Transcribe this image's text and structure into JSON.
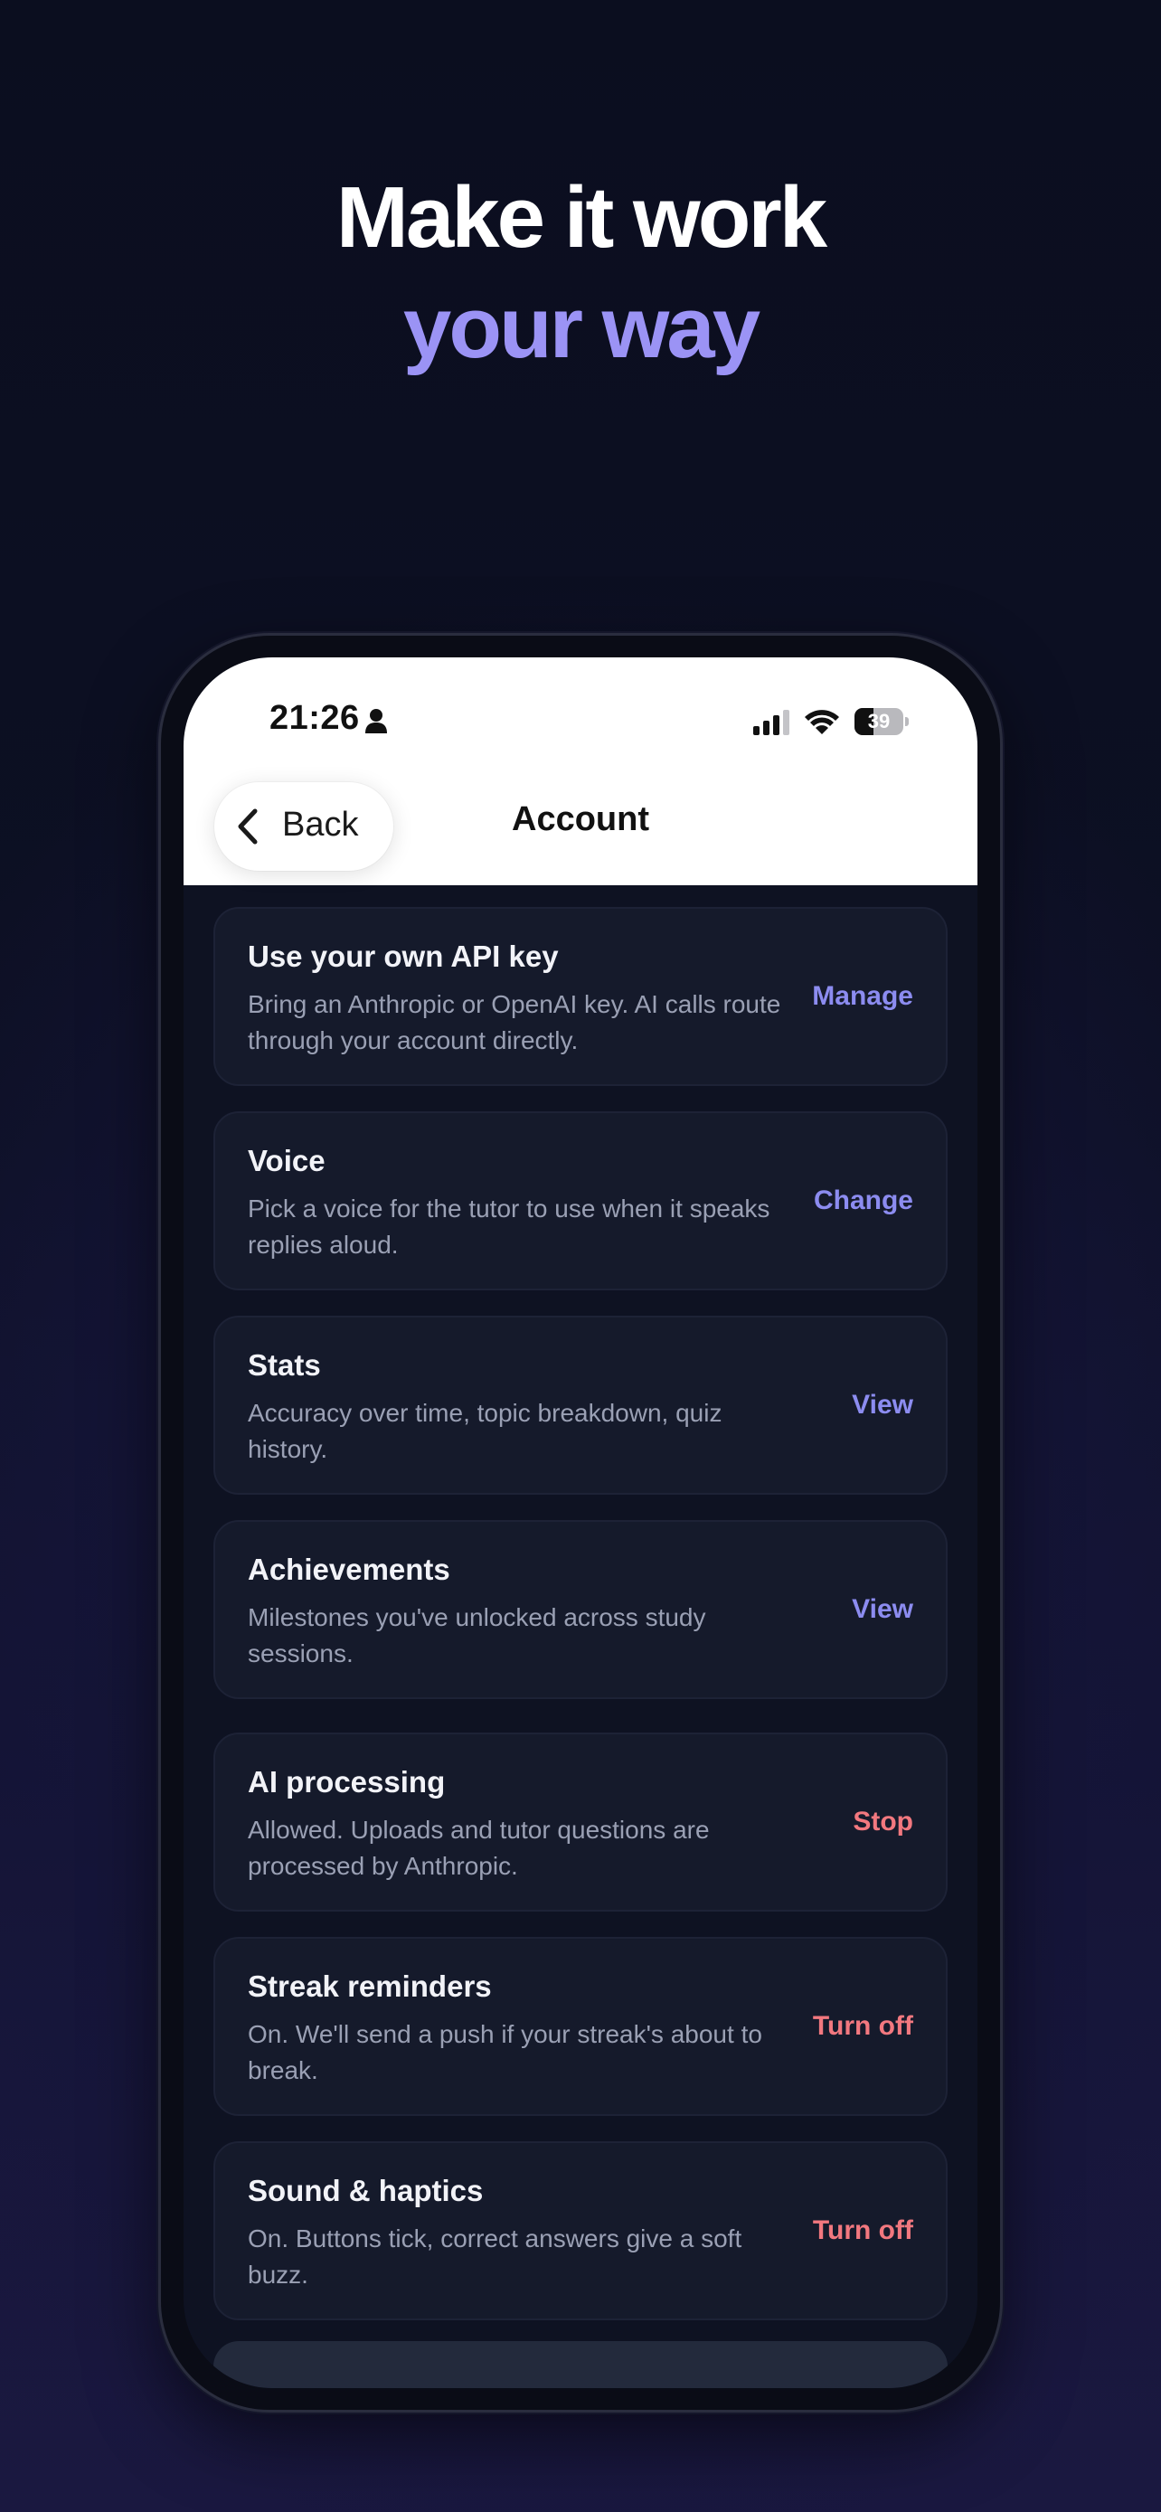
{
  "headline": {
    "line1": "Make it work",
    "line2": "your way",
    "accent_color": "#9b93f5"
  },
  "status_bar": {
    "time": "21:26",
    "battery": "39",
    "battery_level": 0.39,
    "icons": [
      "person-icon",
      "signal-icon",
      "wifi-icon",
      "battery-icon"
    ]
  },
  "nav": {
    "back_label": "Back",
    "title": "Account"
  },
  "settings": [
    {
      "title": "Use your own API key",
      "description": "Bring an Anthropic or OpenAI key. AI calls route through your account directly.",
      "action": "Manage",
      "action_color": "#8c8cf0"
    },
    {
      "title": "Voice",
      "description": "Pick a voice for the tutor to use when it speaks replies aloud.",
      "action": "Change",
      "action_color": "#8c8cf0"
    },
    {
      "title": "Stats",
      "description": "Accuracy over time, topic breakdown, quiz history.",
      "action": "View",
      "action_color": "#8c8cf0"
    },
    {
      "title": "Achievements",
      "description": "Milestones you've unlocked across study sessions.",
      "action": "View",
      "action_color": "#8c8cf0"
    },
    {
      "title": "AI processing",
      "description": "Allowed. Uploads and tutor questions are processed by Anthropic.",
      "action": "Stop",
      "action_color": "#f2787f"
    },
    {
      "title": "Streak reminders",
      "description": "On. We'll send a push if your streak's about to break.",
      "action": "Turn off",
      "action_color": "#f2787f"
    },
    {
      "title": "Sound & haptics",
      "description": "On. Buttons tick, correct answers give a soft buzz.",
      "action": "Turn off",
      "action_color": "#f2787f"
    }
  ]
}
